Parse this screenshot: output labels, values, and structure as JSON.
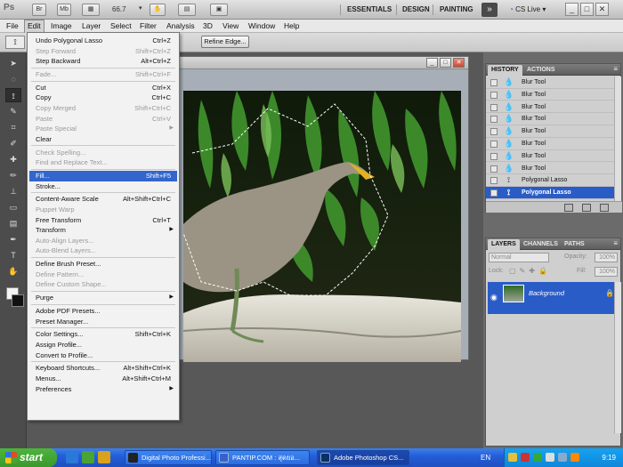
{
  "app": {
    "logo": "Ps",
    "mini_bridge_label": "Br",
    "mini_mb_label": "Mb",
    "zoom": "66.7",
    "workspaces": [
      "ESSENTIALS",
      "DESIGN",
      "PAINTING"
    ],
    "more_workspaces": "»",
    "cs_live": "CS Live",
    "window_controls": [
      "_",
      "□",
      "✕"
    ]
  },
  "menubar": {
    "items": [
      "File",
      "Edit",
      "Image",
      "Layer",
      "Select",
      "Filter",
      "Analysis",
      "3D",
      "View",
      "Window",
      "Help"
    ],
    "active": "Edit"
  },
  "options_bar": {
    "refine_edge": "Refine Edge..."
  },
  "edit_menu": [
    {
      "label": "Undo Polygonal Lasso",
      "shortcut": "Ctrl+Z",
      "disabled": false
    },
    {
      "label": "Step Forward",
      "shortcut": "Shift+Ctrl+Z",
      "disabled": true
    },
    {
      "label": "Step Backward",
      "shortcut": "Alt+Ctrl+Z",
      "disabled": false
    },
    {
      "sep": true
    },
    {
      "label": "Fade...",
      "shortcut": "Shift+Ctrl+F",
      "disabled": true
    },
    {
      "sep": true
    },
    {
      "label": "Cut",
      "shortcut": "Ctrl+X",
      "disabled": false
    },
    {
      "label": "Copy",
      "shortcut": "Ctrl+C",
      "disabled": false
    },
    {
      "label": "Copy Merged",
      "shortcut": "Shift+Ctrl+C",
      "disabled": true
    },
    {
      "label": "Paste",
      "shortcut": "Ctrl+V",
      "disabled": true
    },
    {
      "label": "Paste Special",
      "shortcut": "",
      "disabled": true,
      "submenu": true
    },
    {
      "label": "Clear",
      "shortcut": "",
      "disabled": false
    },
    {
      "sep": true
    },
    {
      "label": "Check Spelling...",
      "shortcut": "",
      "disabled": true
    },
    {
      "label": "Find and Replace Text...",
      "shortcut": "",
      "disabled": true
    },
    {
      "sep": true
    },
    {
      "label": "Fill...",
      "shortcut": "Shift+F5",
      "disabled": false,
      "highlighted": true
    },
    {
      "label": "Stroke...",
      "shortcut": "",
      "disabled": false
    },
    {
      "sep": true
    },
    {
      "label": "Content-Aware Scale",
      "shortcut": "Alt+Shift+Ctrl+C",
      "disabled": false
    },
    {
      "label": "Puppet Warp",
      "shortcut": "",
      "disabled": true
    },
    {
      "label": "Free Transform",
      "shortcut": "Ctrl+T",
      "disabled": false
    },
    {
      "label": "Transform",
      "shortcut": "",
      "disabled": false,
      "submenu": true
    },
    {
      "label": "Auto-Align Layers...",
      "shortcut": "",
      "disabled": true
    },
    {
      "label": "Auto-Blend Layers...",
      "shortcut": "",
      "disabled": true
    },
    {
      "sep": true
    },
    {
      "label": "Define Brush Preset...",
      "shortcut": "",
      "disabled": false
    },
    {
      "label": "Define Pattern...",
      "shortcut": "",
      "disabled": true
    },
    {
      "label": "Define Custom Shape...",
      "shortcut": "",
      "disabled": true
    },
    {
      "sep": true
    },
    {
      "label": "Purge",
      "shortcut": "",
      "disabled": false,
      "submenu": true
    },
    {
      "sep": true
    },
    {
      "label": "Adobe PDF Presets...",
      "shortcut": "",
      "disabled": false
    },
    {
      "label": "Preset Manager...",
      "shortcut": "",
      "disabled": false
    },
    {
      "sep": true
    },
    {
      "label": "Color Settings...",
      "shortcut": "Shift+Ctrl+K",
      "disabled": false
    },
    {
      "label": "Assign Profile...",
      "shortcut": "",
      "disabled": false
    },
    {
      "label": "Convert to Profile...",
      "shortcut": "",
      "disabled": false
    },
    {
      "sep": true
    },
    {
      "label": "Keyboard Shortcuts...",
      "shortcut": "Alt+Shift+Ctrl+K",
      "disabled": false
    },
    {
      "label": "Menus...",
      "shortcut": "Alt+Shift+Ctrl+M",
      "disabled": false
    },
    {
      "label": "Preferences",
      "shortcut": "",
      "disabled": false,
      "submenu": true
    }
  ],
  "history_panel": {
    "tabs": [
      "HISTORY",
      "ACTIONS"
    ],
    "items": [
      {
        "label": "Blur Tool",
        "icon": "drop-icon"
      },
      {
        "label": "Blur Tool",
        "icon": "drop-icon"
      },
      {
        "label": "Blur Tool",
        "icon": "drop-icon"
      },
      {
        "label": "Blur Tool",
        "icon": "drop-icon"
      },
      {
        "label": "Blur Tool",
        "icon": "drop-icon"
      },
      {
        "label": "Blur Tool",
        "icon": "drop-icon"
      },
      {
        "label": "Blur Tool",
        "icon": "drop-icon"
      },
      {
        "label": "Blur Tool",
        "icon": "drop-icon"
      },
      {
        "label": "Polygonal Lasso",
        "icon": "lasso-icon"
      },
      {
        "label": "Polygonal Lasso",
        "icon": "lasso-icon",
        "selected": true
      }
    ]
  },
  "layers_panel": {
    "tabs": [
      "LAYERS",
      "CHANNELS",
      "PATHS"
    ],
    "blend_mode": "Normal",
    "opacity_label": "Opacity:",
    "opacity_value": "100%",
    "lock_label": "Lock:",
    "fill_label": "Fill:",
    "fill_value": "100%",
    "layer_name": "Background"
  },
  "taskbar": {
    "start": "start",
    "buttons": [
      {
        "label": "Digital Photo Professi...",
        "active": false
      },
      {
        "label": "PANTIP.COM : สุดยอ...",
        "active": false
      },
      {
        "label": "Adobe Photoshop CS...",
        "active": true
      }
    ],
    "language": "EN",
    "time": "9:19"
  },
  "colors": {
    "accent": "#2a5cc7",
    "menu_highlight": "#3366cc",
    "taskbar": "#245edb",
    "start": "#3a9a2c"
  }
}
